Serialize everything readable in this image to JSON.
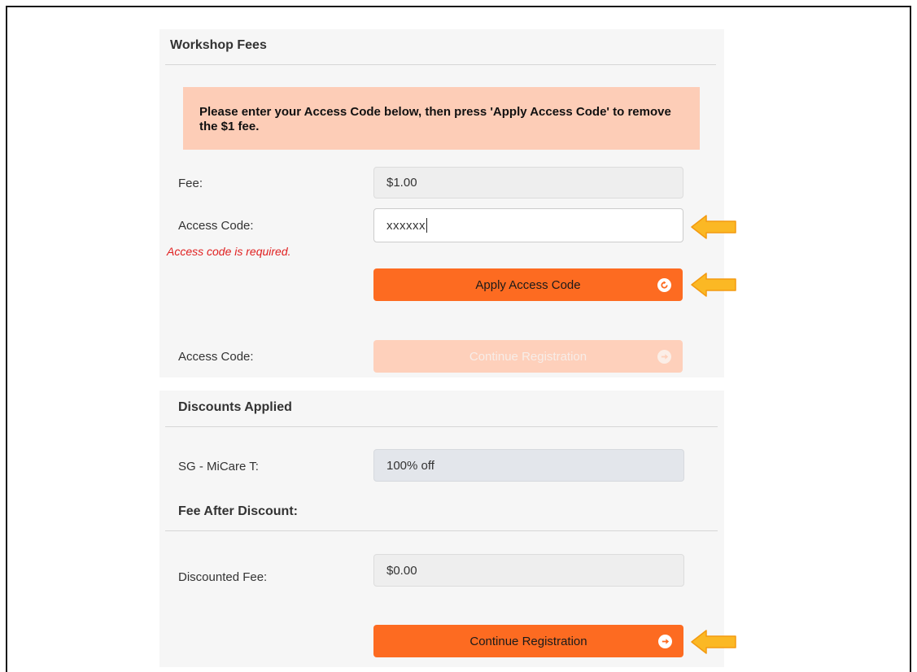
{
  "fees_section": {
    "title": "Workshop Fees",
    "notice": "Please enter your Access Code below, then press 'Apply Access Code' to remove the $1 fee.",
    "fee_label": "Fee:",
    "fee_value": "$1.00",
    "access_code_label": "Access Code:",
    "access_code_value": "xxxxxx",
    "access_code_error": "Access code is required.",
    "apply_button_label": "Apply Access Code",
    "access_code_label_2": "Access Code:",
    "continue_disabled_label": "Continue Registration"
  },
  "discounts_section": {
    "title": "Discounts Applied",
    "discount_label": "SG - MiCare T:",
    "discount_value": "100% off",
    "fee_after_title": "Fee After Discount:",
    "discounted_fee_label": "Discounted Fee:",
    "discounted_fee_value": "$0.00",
    "continue_button_label": "Continue Registration"
  },
  "colors": {
    "primary_button": "#fd6b21",
    "disabled_button": "#fed0bb",
    "notice_background": "#fdcdb7",
    "error_text": "#e02020",
    "callout_arrow": "#fbb824"
  },
  "icons": {
    "apply_button_icon": "refresh-icon",
    "continue_button_icon": "arrow-right-circle-icon",
    "callout": "arrow-left-icon"
  }
}
